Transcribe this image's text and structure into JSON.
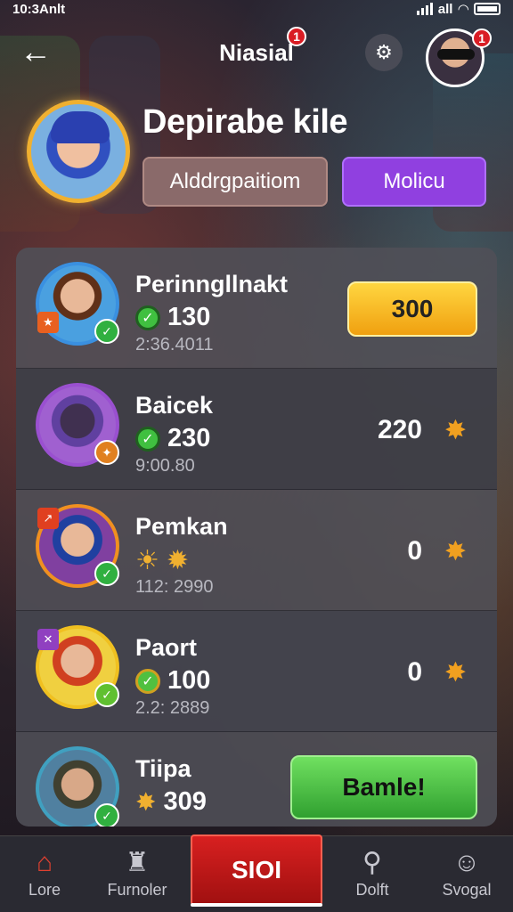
{
  "status_bar": {
    "time": "10:3Anlt",
    "carrier": "all"
  },
  "header": {
    "title": "Niasial",
    "title_badge": "1",
    "avatar_badge": "1"
  },
  "hero": {
    "title": "Depirabe kile",
    "secondary_button": "Alddrgpaitiom",
    "primary_button": "Molicu"
  },
  "list": [
    {
      "name": "Perinngllnakt",
      "score": "130",
      "sub": "2:36.4011",
      "action_label": "300",
      "action_type": "yellow-button"
    },
    {
      "name": "Baicek",
      "score": "230",
      "sub": "9:00.80",
      "value": "220",
      "action_type": "star"
    },
    {
      "name": "Pemkan",
      "score": "",
      "sub": "112: 2990",
      "value": "0",
      "action_type": "star"
    },
    {
      "name": "Paort",
      "score": "100",
      "sub": "2.2: 2889",
      "value": "0",
      "action_type": "star"
    },
    {
      "name": "Tiipa",
      "score": "309",
      "sub": "",
      "action_label": "Bamle!",
      "action_type": "green-button"
    }
  ],
  "nav": {
    "items": [
      {
        "label": "Lore",
        "icon": "home-icon"
      },
      {
        "label": "Furnoler",
        "icon": "puzzle-icon"
      },
      {
        "label": "SIOI",
        "icon": ""
      },
      {
        "label": "Dolft",
        "icon": "search-icon"
      },
      {
        "label": "Svogal",
        "icon": "chat-icon"
      }
    ]
  },
  "colors": {
    "primary_purple": "#9040e0",
    "accent_yellow": "#f0b030",
    "nav_red": "#d82020",
    "go_green": "#40c040"
  }
}
